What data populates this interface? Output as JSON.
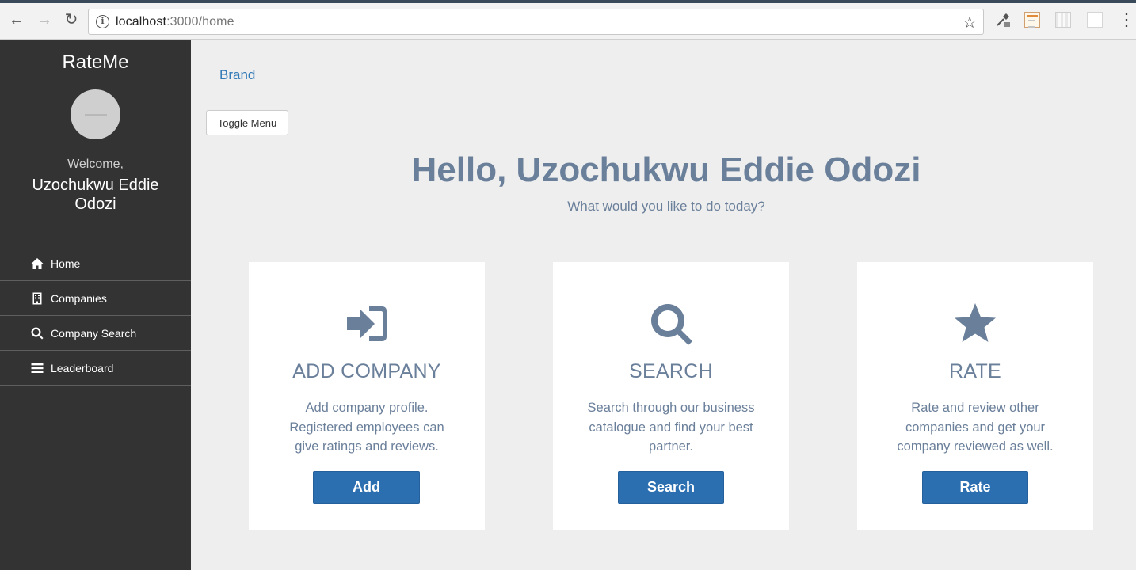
{
  "browser": {
    "url_host": "localhost",
    "url_path": ":3000/home"
  },
  "sidebar": {
    "title": "RateMe",
    "welcome": "Welcome,",
    "user_name": "Uzochukwu Eddie Odozi",
    "items": [
      {
        "label": "Home",
        "icon": "home-icon"
      },
      {
        "label": "Companies",
        "icon": "building-icon"
      },
      {
        "label": "Company Search",
        "icon": "search-icon"
      },
      {
        "label": "Leaderboard",
        "icon": "bars-icon"
      }
    ]
  },
  "topbar": {
    "brand": "Brand",
    "toggle_label": "Toggle Menu"
  },
  "hero": {
    "title": "Hello, Uzochukwu Eddie Odozi",
    "subtitle": "What would you like to do today?"
  },
  "cards": [
    {
      "icon": "sign-in-icon",
      "title": "ADD COMPANY",
      "description": "Add company profile. Registered employees can give ratings and reviews.",
      "button": "Add"
    },
    {
      "icon": "search-icon",
      "title": "SEARCH",
      "description": "Search through our business catalogue and find your best partner.",
      "button": "Search"
    },
    {
      "icon": "star-icon",
      "title": "RATE",
      "description": "Rate and review other companies and get your company reviewed as well.",
      "button": "Rate"
    }
  ],
  "colors": {
    "sidebar_bg": "#333333",
    "accent_text": "#6a7f9a",
    "button_bg": "#2c6fb1",
    "link": "#337ab7",
    "page_bg": "#eeeeee"
  }
}
